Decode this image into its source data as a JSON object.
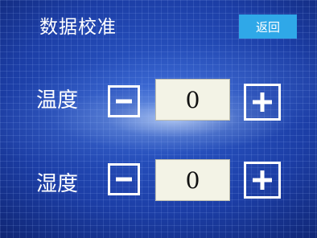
{
  "header": {
    "title": "数据校准",
    "back_label": "返回"
  },
  "rows": [
    {
      "label": "温度",
      "value": "0",
      "minus_icon": "minus-icon",
      "plus_icon": "plus-icon"
    },
    {
      "label": "湿度",
      "value": "0",
      "minus_icon": "minus-icon",
      "plus_icon": "plus-icon"
    }
  ],
  "colors": {
    "accent_button": "#2fa8e8",
    "value_box_bg": "#f3f3e6",
    "text": "#ffffff"
  }
}
